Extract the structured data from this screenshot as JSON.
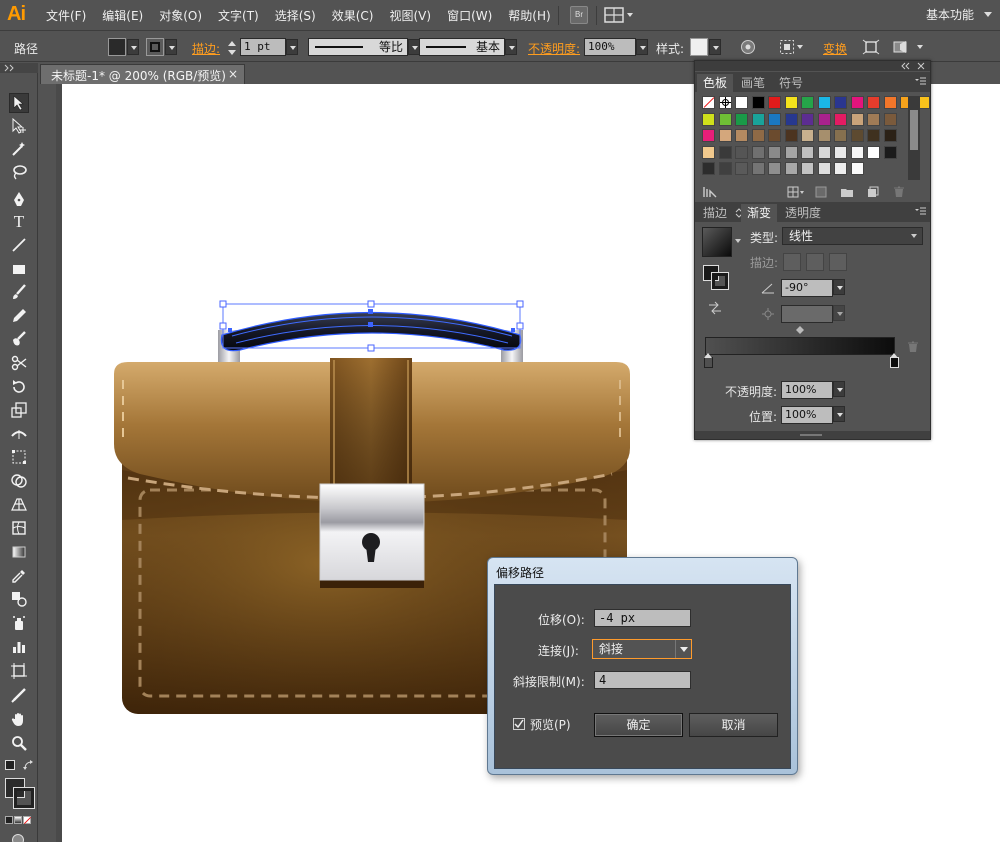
{
  "app": {
    "logo": "Ai",
    "workspace": "基本功能",
    "bridge_button": "Br"
  },
  "menu": [
    "文件(F)",
    "编辑(E)",
    "对象(O)",
    "文字(T)",
    "选择(S)",
    "效果(C)",
    "视图(V)",
    "窗口(W)",
    "帮助(H)"
  ],
  "control_bar": {
    "selection_type": "路径",
    "stroke_label": "描边:",
    "stroke_weight": "1 pt",
    "profile_label": "等比",
    "brush_label": "基本",
    "opacity_label": "不透明度:",
    "opacity_value": "100%",
    "style_label": "样式:",
    "transform_label": "变换"
  },
  "document": {
    "tab_title": "未标题-1* @ 200% (RGB/预览)",
    "close_glyph": "×"
  },
  "swatch_panel": {
    "tabs": [
      "色板",
      "画笔",
      "符号"
    ],
    "active_tab": "色板",
    "swatch_rows": [
      [
        "#ffffff",
        "#000000",
        "#e21b1b",
        "#f4e21c",
        "#25a449",
        "#1ab7e6",
        "#2a3690",
        "#e3147d",
        "#e63c2c",
        "#f2762a",
        "#f7a31b",
        "#f9c21c"
      ],
      [
        "#cfe01b",
        "#6fbf35",
        "#1a9a48",
        "#19a39a",
        "#1a78c2",
        "#27388f",
        "#5c2d91",
        "#a9228d",
        "#e31b63",
        "#c9a37a",
        "#a07b56",
        "#7a5a3c"
      ],
      [
        "#e81e79",
        "#d4a77c",
        "#b48a61",
        "#8f6a46",
        "#6b4b2e",
        "#4c3420",
        "#c8b08e",
        "#a68f6d",
        "#86704f",
        "#5d4a30",
        "#3f311f",
        "#2b2116"
      ],
      [
        "#f1c98d",
        "#3a3a3a",
        "#555555",
        "#707070",
        "#8a8a8a",
        "#a5a5a5",
        "#bfbfbf",
        "#d8d8d8",
        "#e9e9e9",
        "#f6f6f6",
        "#ffffff",
        "#1b1b1b"
      ],
      [
        "#2c2c2c",
        "#404040",
        "#5a5a5a",
        "#747474",
        "#8e8e8e",
        "#a8a8a8",
        "#c3c3c3",
        "#dedede",
        "#eeeeee",
        "#fafafa"
      ]
    ]
  },
  "gradient_panel": {
    "tabs": [
      "描边",
      "渐变",
      "透明度"
    ],
    "active_tab": "渐变",
    "type_label": "类型:",
    "type_value": "线性",
    "stroke_label": "描边:",
    "angle_value": "-90°",
    "opacity_label": "不透明度:",
    "opacity_value": "100%",
    "location_label": "位置:",
    "location_value": "100%",
    "gradient_start": "#505050",
    "gradient_end": "#0c0c0c"
  },
  "dialog": {
    "title": "偏移路径",
    "offset_label": "位移(O):",
    "offset_value": "-4 px",
    "join_label": "连接(J):",
    "join_value": "斜接",
    "miter_label": "斜接限制(M):",
    "miter_value": "4",
    "preview_label": "预览(P)",
    "preview_checked": true,
    "ok_label": "确定",
    "cancel_label": "取消"
  },
  "colors": {
    "accent": "#ff9b2c",
    "chrome": "#535353",
    "leather_light": "#b48a52",
    "leather_dark": "#4b2e12",
    "handle": "#1f2a44"
  },
  "tools": [
    "selection-tool",
    "direct-selection-tool",
    "magic-wand-tool",
    "lasso-tool",
    "pen-tool",
    "type-tool",
    "line-tool",
    "rectangle-tool",
    "paintbrush-tool",
    "pencil-tool",
    "blob-brush-tool",
    "scissors-tool",
    "rotate-tool",
    "scale-tool",
    "width-tool",
    "free-transform-tool",
    "shape-builder-tool",
    "perspective-grid-tool",
    "mesh-tool",
    "gradient-tool",
    "eyedropper-tool",
    "blend-tool",
    "symbol-sprayer-tool",
    "column-graph-tool",
    "artboard-tool",
    "slice-tool",
    "hand-tool",
    "zoom-tool"
  ]
}
